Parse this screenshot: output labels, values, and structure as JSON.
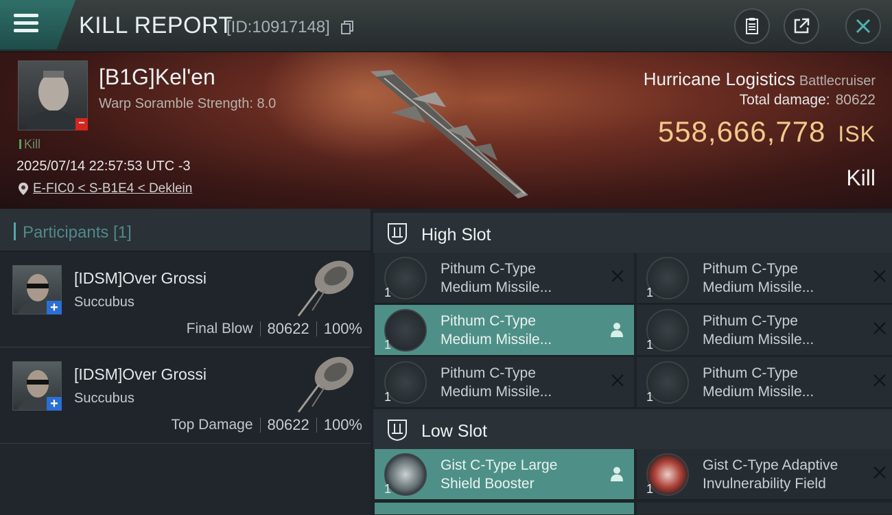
{
  "header": {
    "title": "KILL REPORT",
    "report_id": "[ID:10917148]",
    "icons": [
      "menu-icon",
      "copy-icon",
      "clipboard-icon",
      "share-icon",
      "close-icon"
    ]
  },
  "victim": {
    "name": "[B1G]Kel'en",
    "scramble": "Warp Soramble Strength: 8.0",
    "tag": "Kill",
    "time": "2025/07/14 22:57:53 UTC -3",
    "location": "E-FIC0 < S-B1E4 < Deklein",
    "ship": "Hurricane Logistics",
    "ship_class": "Battlecruiser",
    "total_damage_label": "Total damage:",
    "total_damage": "80622",
    "isk_value": "558,666,778",
    "isk_unit": "ISK",
    "result": "Kill"
  },
  "participants": {
    "label": "Participants [1]",
    "rows": [
      {
        "name": "[IDSM]Over Grossi",
        "ship": "Succubus",
        "role": "Final Blow",
        "damage": "80622",
        "percent": "100%"
      },
      {
        "name": "[IDSM]Over Grossi",
        "ship": "Succubus",
        "role": "Top Damage",
        "damage": "80622",
        "percent": "100%"
      }
    ]
  },
  "slots": {
    "high": {
      "title": "High Slot",
      "items": [
        {
          "l1": "Pithum C-Type",
          "l2": "Medium Missile...",
          "qty": "1"
        },
        {
          "l1": "Pithum C-Type",
          "l2": "Medium Missile...",
          "qty": "1"
        },
        {
          "l1": "Pithum C-Type",
          "l2": "Medium Missile...",
          "qty": "1"
        },
        {
          "l1": "Pithum C-Type",
          "l2": "Medium Missile...",
          "qty": "1"
        },
        {
          "l1": "Pithum C-Type",
          "l2": "Medium Missile...",
          "qty": "1"
        },
        {
          "l1": "Pithum C-Type",
          "l2": "Medium Missile...",
          "qty": "1"
        }
      ]
    },
    "low": {
      "title": "Low Slot",
      "items": [
        {
          "l1": "Gist C-Type Large",
          "l2": "Shield Booster",
          "qty": "1"
        },
        {
          "l1": "Gist C-Type Adaptive",
          "l2": "Invulnerability Field",
          "qty": "1"
        }
      ]
    }
  },
  "colors": {
    "accent": "#4e9087",
    "isk": "#f3c98c",
    "minus_badge": "#d3261f",
    "plus_badge": "#2b6fd6"
  }
}
